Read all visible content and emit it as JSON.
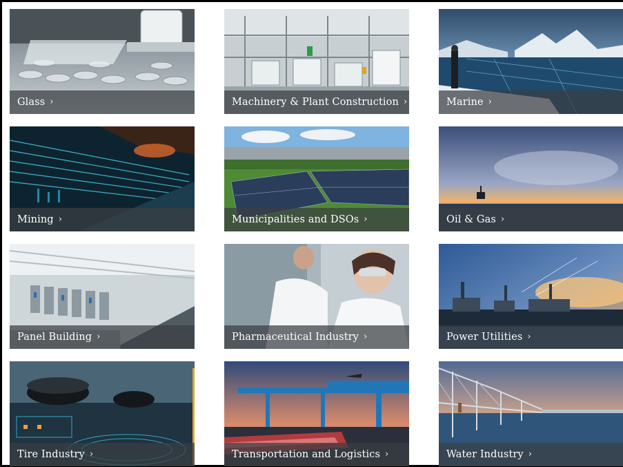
{
  "industries": [
    {
      "label": "Glass"
    },
    {
      "label": "Machinery & Plant Construction"
    },
    {
      "label": "Marine"
    },
    {
      "label": "Mining"
    },
    {
      "label": "Municipalities and DSOs"
    },
    {
      "label": "Oil & Gas"
    },
    {
      "label": "Panel Building"
    },
    {
      "label": "Pharmaceutical Industry"
    },
    {
      "label": "Power Utilities"
    },
    {
      "label": "Tire Industry"
    },
    {
      "label": "Transportation and Logistics"
    },
    {
      "label": "Water Industry"
    }
  ],
  "chevron": "›"
}
